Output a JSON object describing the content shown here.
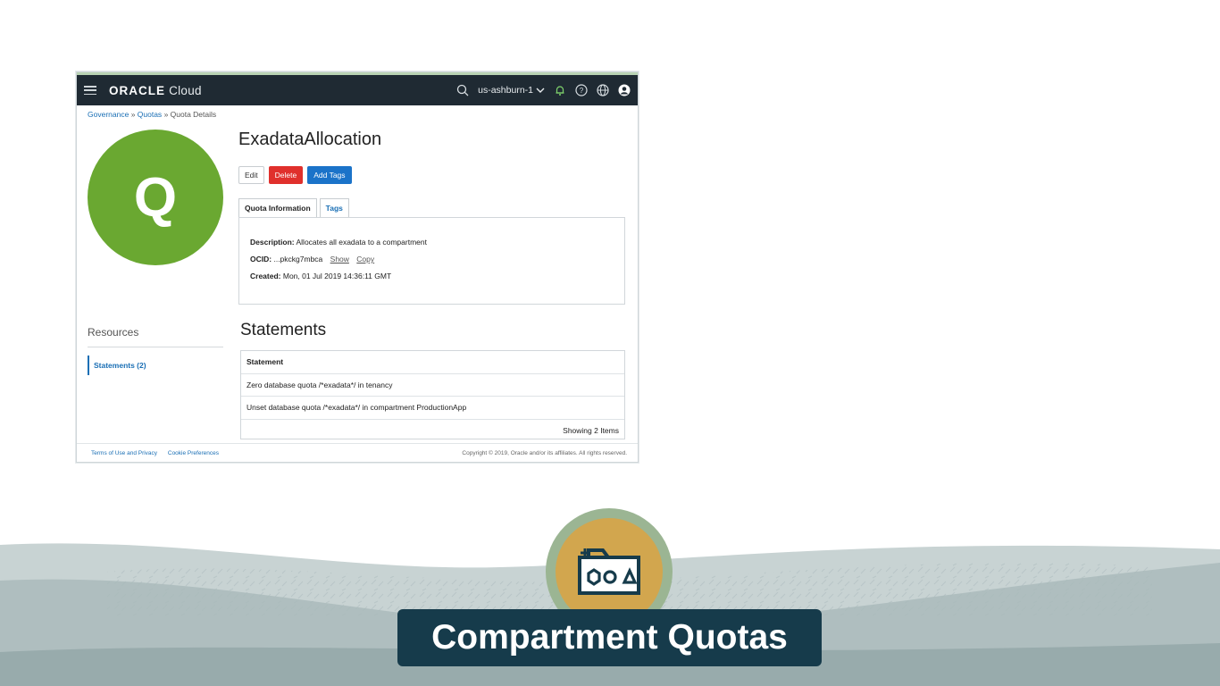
{
  "header": {
    "logo_brand": "ORACLE",
    "logo_product": "Cloud",
    "region": "us-ashburn-1"
  },
  "breadcrumb": {
    "items": [
      "Governance",
      "Quotas"
    ],
    "current": "Quota Details"
  },
  "avatar": {
    "letter": "Q",
    "color": "#6aa831"
  },
  "page": {
    "title": "ExadataAllocation",
    "buttons": {
      "edit": "Edit",
      "delete": "Delete",
      "add_tags": "Add Tags"
    },
    "tabs": [
      "Quota Information",
      "Tags"
    ]
  },
  "info": {
    "description_label": "Description:",
    "description_value": "Allocates all exadata to a compartment",
    "ocid_label": "OCID:",
    "ocid_value": "...pkckg7mbca",
    "show": "Show",
    "copy": "Copy",
    "created_label": "Created:",
    "created_value": "Mon, 01 Jul 2019 14:36:11 GMT"
  },
  "resources": {
    "title": "Resources",
    "items": [
      "Statements (2)"
    ]
  },
  "statements": {
    "title": "Statements",
    "column": "Statement",
    "rows": [
      "Zero database quota /*exadata*/ in tenancy",
      "Unset database quota /*exadata*/ in compartment ProductionApp"
    ],
    "footer": "Showing 2 Items"
  },
  "footer": {
    "terms": "Terms of Use and Privacy",
    "cookies": "Cookie Preferences",
    "copyright": "Copyright © 2019, Oracle and/or its affiliates. All rights reserved."
  },
  "banner": {
    "title": "Compartment Quotas",
    "emblem_icon": "folder-shapes-icon"
  },
  "colors": {
    "topbar": "#1f2a33",
    "link": "#1a6fb5",
    "delete": "#e0302c",
    "add_tags": "#1b73c9",
    "banner": "#163b4b",
    "emblem": "#d2a64e"
  }
}
